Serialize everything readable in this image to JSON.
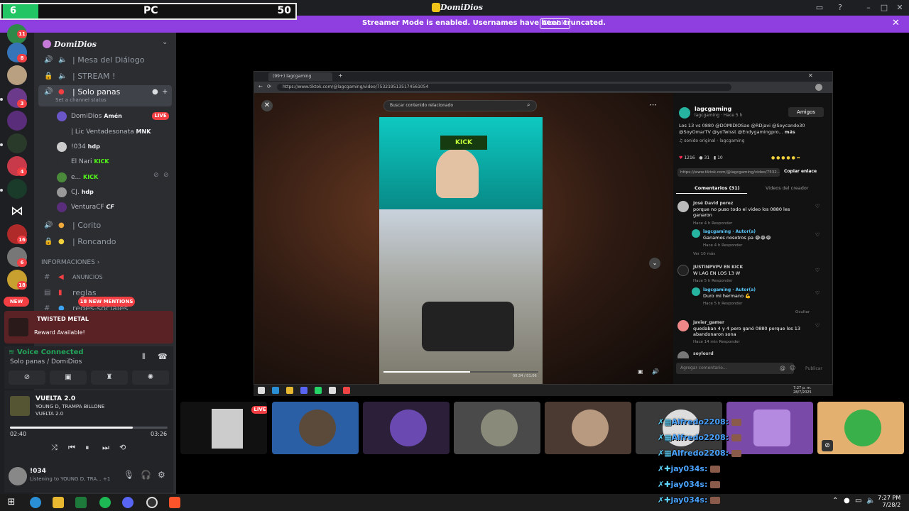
{
  "window": {
    "title": "DomiDios"
  },
  "score": {
    "left": "6",
    "label": "PC",
    "right": "50"
  },
  "streamer_banner": {
    "text": "Streamer Mode is enabled. Usernames have been truncated.",
    "button": "Disable"
  },
  "guild_badges": [
    "11",
    "8",
    "3",
    "4",
    "16",
    "6",
    "18"
  ],
  "guild_new": "NEW",
  "server": {
    "name": "DomiDios"
  },
  "channels": [
    {
      "name": "| Mesa del Diálogo"
    },
    {
      "name": "| STREAM !"
    },
    {
      "name": "| Solo panas",
      "status_hint": "Set a channel status"
    },
    {
      "name": "| Corito"
    },
    {
      "name": "| Roncando"
    }
  ],
  "voice_users": [
    {
      "name": "DomiDios",
      "tag": "Amén",
      "live": "LIVE"
    },
    {
      "name": "| Lic Ventadesonata",
      "tag": "MNK"
    },
    {
      "name": "!034",
      "tag": "hdp"
    },
    {
      "name": "El Nari",
      "tag": "KICK"
    },
    {
      "name": "e...",
      "tag": "KICK"
    },
    {
      "name": "CJ.",
      "tag": "hdp"
    },
    {
      "name": "VenturaCF",
      "tag": "CF"
    }
  ],
  "category": "INFORMACIONES",
  "info_channels": [
    "ANUNCIOS",
    "reglas",
    "redes-sociales"
  ],
  "mentions": "18 NEW MENTIONS",
  "reward": {
    "title": "TWISTED METAL",
    "text": "Reward Available!"
  },
  "voice": {
    "status": "Voice Connected",
    "channel": "Solo panas / DomiDios"
  },
  "music": {
    "title": "VUELTA 2.0",
    "artist": "YOUNG D, TRAMPA BILLONE",
    "album": "VUELTA 2.0",
    "current": "02:40",
    "duration": "03:26",
    "progress": 0.78
  },
  "user": {
    "name": "!034",
    "status": "Listening to YOUNG D, TRA...",
    "extra": "+1"
  },
  "browser": {
    "tab": "(99+) lagcgaming (@lagcga...",
    "url": "https://www.tiktok.com/@lagcgaming/video/7532195135174561054"
  },
  "tiktok": {
    "search_placeholder": "Buscar contenido relacionado",
    "cam_sign": "KICK",
    "video_progress": 0.56,
    "video_timer": "00:34 / 01:06",
    "author": "lagcgaming",
    "author_sub": "lagcgaming · Hace 5 h",
    "friends_btn": "Amigos",
    "caption": "Los 13 vs 0880 @DOMIDIOSao @RDjavi @Soycando30 @SoyOmarTV @yoTwisst @Endygamingpro...",
    "caption_more": "más",
    "sound": "sonido original - lagcgaming",
    "likes": "1216",
    "comments_count": "31",
    "saves": "10",
    "link": "https://www.tiktok.com/@lagcgaming/video/7532...",
    "copy_btn": "Copiar enlace",
    "tab_comments": "Comentarios (31)",
    "tab_videos": "Videos del creador",
    "comments": [
      {
        "name": "José David perez",
        "text": "porque no puso todo el video los 0880 les ganaron",
        "meta": "Hace 4 h   Responder"
      },
      {
        "name": "lagcgaming · Autor(a)",
        "text": "Ganamos nosotros pa 😂😂😂",
        "meta": "Hace 4 h   Responder"
      },
      {
        "name": "JUSTINPVPV EN KICK",
        "text": "W LAG EN LOS 13 W",
        "meta": "Hace 5 h   Responder"
      },
      {
        "name": "lagcgaming · Autor(a)",
        "text": "Duro mi hermano 💪",
        "meta": "Hace 5 h   Responder"
      },
      {
        "name": "Javier_gamer",
        "text": "quedaban 4 y 4 pero ganó 0880 porque los 13 abandonaron sona",
        "meta": "Hace 14 min   Responder"
      },
      {
        "name": "soylosrd",
        "text": "",
        "meta": ""
      }
    ],
    "view_more": "Ver 10 más",
    "hide": "Ocultar",
    "comment_placeholder": "Agregar comentario...",
    "post": "Publicar"
  },
  "vm_clock": {
    "time": "7:27 p. m.",
    "date": "28/7/2025"
  },
  "tiles_live": "LIVE",
  "chat_overlay": [
    {
      "user": "Alfredo2208:"
    },
    {
      "user": "Alfredo2208:"
    },
    {
      "user": "Alfredo2208:"
    },
    {
      "user": "jay034s:"
    },
    {
      "user": "jay034s:"
    },
    {
      "user": "jay034s:"
    }
  ],
  "taskbar": {
    "time": "7:27 PM",
    "date": "7/28/2"
  }
}
